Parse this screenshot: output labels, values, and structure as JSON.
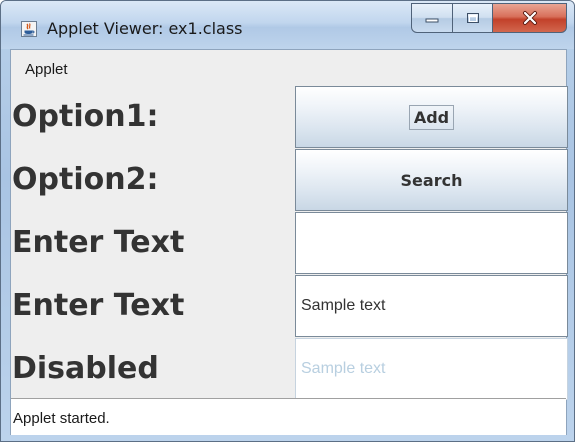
{
  "window": {
    "title": "Applet Viewer: ex1.class",
    "icon": "java-applet-icon",
    "controls": {
      "minimize_icon": "minimize-icon",
      "maximize_icon": "maximize-icon",
      "close_icon": "close-icon"
    }
  },
  "menubar": {
    "items": [
      {
        "label": "Applet"
      }
    ]
  },
  "form": {
    "rows": [
      {
        "label": "Option1:",
        "control": "button",
        "button_label": "Add"
      },
      {
        "label": "Option2:",
        "control": "button",
        "button_label": "Search"
      },
      {
        "label": "Enter Text",
        "control": "textfield",
        "value": ""
      },
      {
        "label": "Enter Text",
        "control": "textfield",
        "value": "Sample text"
      },
      {
        "label": "Disabled",
        "control": "textfield-disabled",
        "value": "Sample text"
      }
    ]
  },
  "status": {
    "text": "Applet started."
  },
  "colors": {
    "title_bar": "#c1d6ee",
    "close_button": "#c2412a",
    "panel_background": "#eeeeee",
    "label_text": "#333333",
    "disabled_text": "#b8cfe0"
  }
}
